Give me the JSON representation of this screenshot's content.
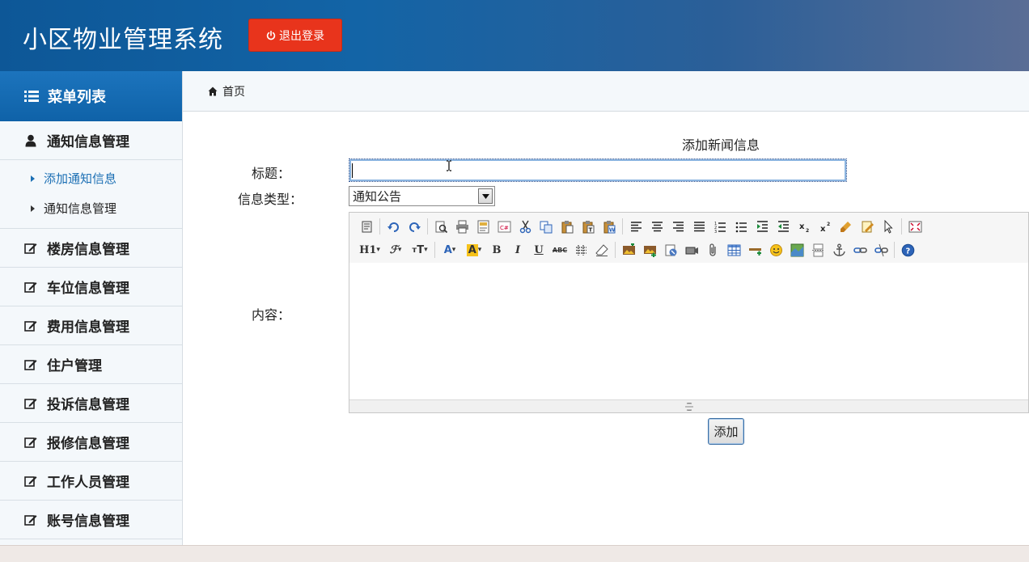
{
  "header": {
    "app_title": "小区物业管理系统",
    "logout_label": "退出登录",
    "logout_color": "#e8341c"
  },
  "sidebar": {
    "heading": "菜单列表",
    "groups": [
      {
        "label": "通知信息管理",
        "icon": "user-icon",
        "expanded": true,
        "items": [
          {
            "label": "添加通知信息",
            "active": true
          },
          {
            "label": "通知信息管理",
            "active": false
          }
        ]
      },
      {
        "label": "楼房信息管理",
        "icon": "edit-icon"
      },
      {
        "label": "车位信息管理",
        "icon": "edit-icon"
      },
      {
        "label": "费用信息管理",
        "icon": "edit-icon"
      },
      {
        "label": "住户管理",
        "icon": "edit-icon"
      },
      {
        "label": "投诉信息管理",
        "icon": "edit-icon"
      },
      {
        "label": "报修信息管理",
        "icon": "edit-icon"
      },
      {
        "label": "工作人员管理",
        "icon": "edit-icon"
      },
      {
        "label": "账号信息管理",
        "icon": "edit-icon"
      }
    ]
  },
  "breadcrumb": {
    "home": "首页"
  },
  "form": {
    "title": "添加新闻信息",
    "title_label": "标题：",
    "title_value": "",
    "type_label": "信息类型：",
    "type_selected": "通知公告",
    "content_label": "内容：",
    "submit_label": "添加"
  },
  "editor": {
    "row1_icons": [
      "source-icon",
      "sep",
      "undo-icon",
      "redo-icon",
      "sep",
      "preview-icon",
      "print-icon",
      "template-icon",
      "code-icon",
      "cut-icon",
      "copy-icon",
      "paste-icon",
      "paste-text-icon",
      "paste-word-icon",
      "sep",
      "align-left-icon",
      "align-center-icon",
      "align-right-icon",
      "align-justify-icon",
      "ordered-list-icon",
      "unordered-list-icon",
      "indent-icon",
      "outdent-icon",
      "subscript-icon",
      "superscript-icon",
      "clear-format-icon",
      "select-all-icon",
      "pointer-icon",
      "sep",
      "fullscreen-icon"
    ],
    "row2_icons": [
      "heading-icon",
      "font-family-icon",
      "font-size-icon",
      "sep",
      "font-color-icon",
      "highlight-icon",
      "bold-icon",
      "italic-icon",
      "underline-icon",
      "strikethrough-icon",
      "line-height-icon",
      "eraser-icon",
      "sep",
      "image-icon",
      "multi-image-icon",
      "flash-icon",
      "media-icon",
      "attachment-icon",
      "table-icon",
      "hr-icon",
      "emoticon-icon",
      "map-icon",
      "pagebreak-icon",
      "anchor-icon",
      "link-icon",
      "unlink-icon",
      "sep",
      "help-icon"
    ],
    "heading_label": "H1",
    "bold_label": "B",
    "italic_label": "I",
    "underline_label": "U",
    "strike_label": "ABC"
  }
}
